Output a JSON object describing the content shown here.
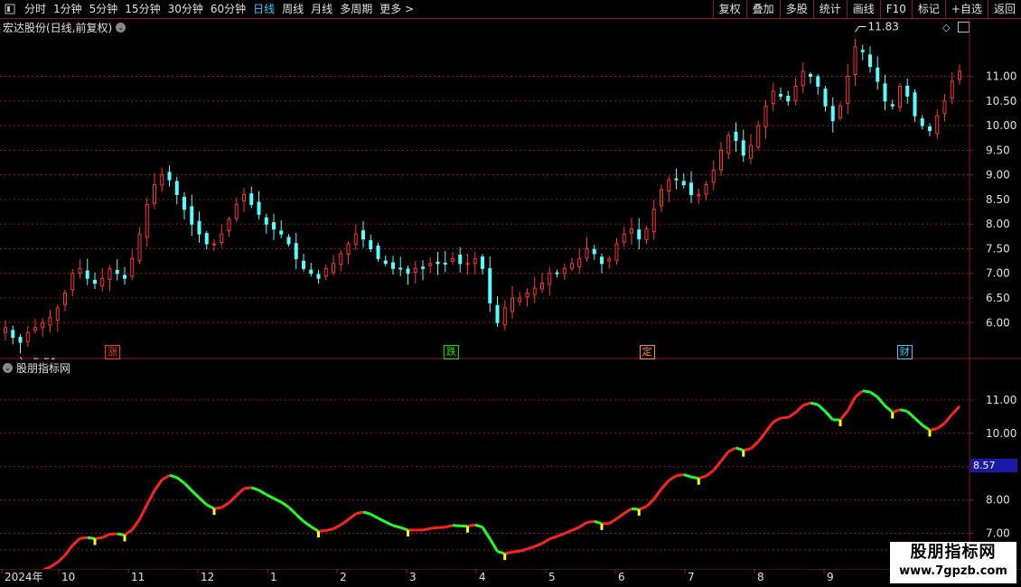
{
  "toolbar": {
    "items": [
      "分时",
      "1分钟",
      "5分钟",
      "15分钟",
      "30分钟",
      "60分钟",
      "日线",
      "周线",
      "月线",
      "多周期",
      "更多"
    ],
    "active_index": 6,
    "more_arrow": ">",
    "right_buttons": [
      "复权",
      "叠加",
      "多股",
      "统计",
      "画线",
      "F10",
      "标记",
      "+自选",
      "返回"
    ]
  },
  "main_panel": {
    "title": "宏达股份(日线,前复权)",
    "high_label": "11.83",
    "low_label": "5.51",
    "price_axis_labels": [
      "11.00",
      "10.50",
      "10.00",
      "9.50",
      "9.00",
      "8.50",
      "8.00",
      "7.50",
      "7.00",
      "6.50",
      "6.00"
    ],
    "price_axis_values": [
      11.0,
      10.5,
      10.0,
      9.5,
      9.0,
      8.5,
      8.0,
      7.5,
      7.0,
      6.5,
      6.0
    ],
    "events": [
      {
        "label": "涨",
        "color": "#ff3030",
        "pos": 0.11
      },
      {
        "label": "跌",
        "color": "#00e000",
        "pos": 0.465
      },
      {
        "label": "定",
        "color": "#ff8a1a",
        "pos": 0.67
      },
      {
        "label": "财",
        "color": "#36c8ff",
        "pos": 0.94
      }
    ]
  },
  "indicator_panel": {
    "title": "股朋指标网",
    "axis_labels": [
      "11.00",
      "10.00",
      "8.00",
      "7.00"
    ],
    "axis_values": [
      11.0,
      10.0,
      8.0,
      7.0
    ],
    "current_value": "8.57"
  },
  "time_axis": {
    "labels": [
      "2024年",
      "10",
      "11",
      "12",
      "1",
      "2",
      "3",
      "4",
      "5",
      "6",
      "7",
      "8",
      "9"
    ]
  },
  "watermark": {
    "title": "股朋指标网",
    "url": "www.7gpzb.com"
  },
  "colors": {
    "up": "#ff3232",
    "down": "#54ffff",
    "grid": "#8b1a1a",
    "line_up": "#ff2020",
    "line_down": "#20ff20",
    "marker": "#ffff00"
  },
  "chart_data": {
    "type": "candlestick",
    "title": "宏达股份(日线,前复权)",
    "ylim": [
      5.4,
      12.0
    ],
    "close_series": [
      5.9,
      5.7,
      5.6,
      5.8,
      5.9,
      6.0,
      6.1,
      6.3,
      6.6,
      7.0,
      7.1,
      6.9,
      6.8,
      6.9,
      7.1,
      7.0,
      6.9,
      7.3,
      7.8,
      8.4,
      8.8,
      9.0,
      8.9,
      8.6,
      8.3,
      8.0,
      7.8,
      7.6,
      7.6,
      7.8,
      8.1,
      8.4,
      8.6,
      8.4,
      8.2,
      8.0,
      7.9,
      7.8,
      7.6,
      7.3,
      7.1,
      7.0,
      6.9,
      7.1,
      7.2,
      7.4,
      7.6,
      7.8,
      7.7,
      7.5,
      7.3,
      7.2,
      7.1,
      7.1,
      7.0,
      7.1,
      7.1,
      7.2,
      7.2,
      7.2,
      7.3,
      7.2,
      7.2,
      7.3,
      7.1,
      6.4,
      6.0,
      6.3,
      6.5,
      6.5,
      6.6,
      6.7,
      6.8,
      7.0,
      7.0,
      7.1,
      7.2,
      7.3,
      7.5,
      7.4,
      7.2,
      7.3,
      7.6,
      7.8,
      7.9,
      7.7,
      7.9,
      8.3,
      8.7,
      8.9,
      8.9,
      8.8,
      8.6,
      8.6,
      8.8,
      9.1,
      9.5,
      9.8,
      9.7,
      9.4,
      9.6,
      10.0,
      10.4,
      10.7,
      10.6,
      10.5,
      10.8,
      11.1,
      11.0,
      10.8,
      10.4,
      10.1,
      10.4,
      11.0,
      11.6,
      11.5,
      11.2,
      10.9,
      10.5,
      10.4,
      10.8,
      10.6,
      10.2,
      10.0,
      9.9,
      10.2,
      10.5,
      10.9,
      11.1
    ]
  }
}
